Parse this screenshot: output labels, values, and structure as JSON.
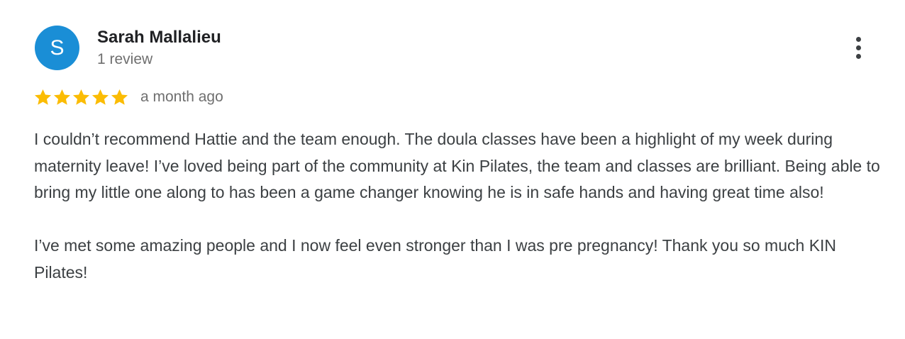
{
  "reviewer": {
    "initial": "S",
    "name": "Sarah Mallalieu",
    "review_count": "1 review",
    "avatar_color": "#1a8ed6"
  },
  "menu": {
    "icon": "more-vert-icon"
  },
  "rating": {
    "stars": 5,
    "max_stars": 5,
    "star_color": "#fbbc04",
    "time_ago": "a month ago"
  },
  "review": {
    "paragraphs": [
      "I couldn’t recommend Hattie and the team enough. The doula classes have been a highlight of my week during maternity leave! I’ve loved being part of the community at Kin Pilates, the team and classes are brilliant. Being able to bring my little one along to has been a game changer knowing he is in safe hands and having great time also!",
      "I’ve met some amazing people and I now feel even stronger than I was pre pregnancy! Thank you so much KIN Pilates!"
    ]
  }
}
